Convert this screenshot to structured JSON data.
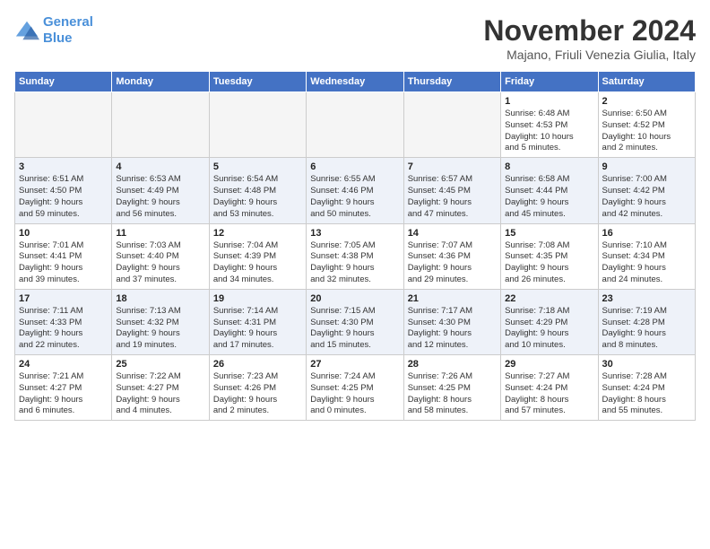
{
  "logo": {
    "line1": "General",
    "line2": "Blue"
  },
  "title": "November 2024",
  "subtitle": "Majano, Friuli Venezia Giulia, Italy",
  "days_of_week": [
    "Sunday",
    "Monday",
    "Tuesday",
    "Wednesday",
    "Thursday",
    "Friday",
    "Saturday"
  ],
  "weeks": [
    [
      {
        "day": "",
        "info": ""
      },
      {
        "day": "",
        "info": ""
      },
      {
        "day": "",
        "info": ""
      },
      {
        "day": "",
        "info": ""
      },
      {
        "day": "",
        "info": ""
      },
      {
        "day": "1",
        "info": "Sunrise: 6:48 AM\nSunset: 4:53 PM\nDaylight: 10 hours\nand 5 minutes."
      },
      {
        "day": "2",
        "info": "Sunrise: 6:50 AM\nSunset: 4:52 PM\nDaylight: 10 hours\nand 2 minutes."
      }
    ],
    [
      {
        "day": "3",
        "info": "Sunrise: 6:51 AM\nSunset: 4:50 PM\nDaylight: 9 hours\nand 59 minutes."
      },
      {
        "day": "4",
        "info": "Sunrise: 6:53 AM\nSunset: 4:49 PM\nDaylight: 9 hours\nand 56 minutes."
      },
      {
        "day": "5",
        "info": "Sunrise: 6:54 AM\nSunset: 4:48 PM\nDaylight: 9 hours\nand 53 minutes."
      },
      {
        "day": "6",
        "info": "Sunrise: 6:55 AM\nSunset: 4:46 PM\nDaylight: 9 hours\nand 50 minutes."
      },
      {
        "day": "7",
        "info": "Sunrise: 6:57 AM\nSunset: 4:45 PM\nDaylight: 9 hours\nand 47 minutes."
      },
      {
        "day": "8",
        "info": "Sunrise: 6:58 AM\nSunset: 4:44 PM\nDaylight: 9 hours\nand 45 minutes."
      },
      {
        "day": "9",
        "info": "Sunrise: 7:00 AM\nSunset: 4:42 PM\nDaylight: 9 hours\nand 42 minutes."
      }
    ],
    [
      {
        "day": "10",
        "info": "Sunrise: 7:01 AM\nSunset: 4:41 PM\nDaylight: 9 hours\nand 39 minutes."
      },
      {
        "day": "11",
        "info": "Sunrise: 7:03 AM\nSunset: 4:40 PM\nDaylight: 9 hours\nand 37 minutes."
      },
      {
        "day": "12",
        "info": "Sunrise: 7:04 AM\nSunset: 4:39 PM\nDaylight: 9 hours\nand 34 minutes."
      },
      {
        "day": "13",
        "info": "Sunrise: 7:05 AM\nSunset: 4:38 PM\nDaylight: 9 hours\nand 32 minutes."
      },
      {
        "day": "14",
        "info": "Sunrise: 7:07 AM\nSunset: 4:36 PM\nDaylight: 9 hours\nand 29 minutes."
      },
      {
        "day": "15",
        "info": "Sunrise: 7:08 AM\nSunset: 4:35 PM\nDaylight: 9 hours\nand 26 minutes."
      },
      {
        "day": "16",
        "info": "Sunrise: 7:10 AM\nSunset: 4:34 PM\nDaylight: 9 hours\nand 24 minutes."
      }
    ],
    [
      {
        "day": "17",
        "info": "Sunrise: 7:11 AM\nSunset: 4:33 PM\nDaylight: 9 hours\nand 22 minutes."
      },
      {
        "day": "18",
        "info": "Sunrise: 7:13 AM\nSunset: 4:32 PM\nDaylight: 9 hours\nand 19 minutes."
      },
      {
        "day": "19",
        "info": "Sunrise: 7:14 AM\nSunset: 4:31 PM\nDaylight: 9 hours\nand 17 minutes."
      },
      {
        "day": "20",
        "info": "Sunrise: 7:15 AM\nSunset: 4:30 PM\nDaylight: 9 hours\nand 15 minutes."
      },
      {
        "day": "21",
        "info": "Sunrise: 7:17 AM\nSunset: 4:30 PM\nDaylight: 9 hours\nand 12 minutes."
      },
      {
        "day": "22",
        "info": "Sunrise: 7:18 AM\nSunset: 4:29 PM\nDaylight: 9 hours\nand 10 minutes."
      },
      {
        "day": "23",
        "info": "Sunrise: 7:19 AM\nSunset: 4:28 PM\nDaylight: 9 hours\nand 8 minutes."
      }
    ],
    [
      {
        "day": "24",
        "info": "Sunrise: 7:21 AM\nSunset: 4:27 PM\nDaylight: 9 hours\nand 6 minutes."
      },
      {
        "day": "25",
        "info": "Sunrise: 7:22 AM\nSunset: 4:27 PM\nDaylight: 9 hours\nand 4 minutes."
      },
      {
        "day": "26",
        "info": "Sunrise: 7:23 AM\nSunset: 4:26 PM\nDaylight: 9 hours\nand 2 minutes."
      },
      {
        "day": "27",
        "info": "Sunrise: 7:24 AM\nSunset: 4:25 PM\nDaylight: 9 hours\nand 0 minutes."
      },
      {
        "day": "28",
        "info": "Sunrise: 7:26 AM\nSunset: 4:25 PM\nDaylight: 8 hours\nand 58 minutes."
      },
      {
        "day": "29",
        "info": "Sunrise: 7:27 AM\nSunset: 4:24 PM\nDaylight: 8 hours\nand 57 minutes."
      },
      {
        "day": "30",
        "info": "Sunrise: 7:28 AM\nSunset: 4:24 PM\nDaylight: 8 hours\nand 55 minutes."
      }
    ]
  ]
}
